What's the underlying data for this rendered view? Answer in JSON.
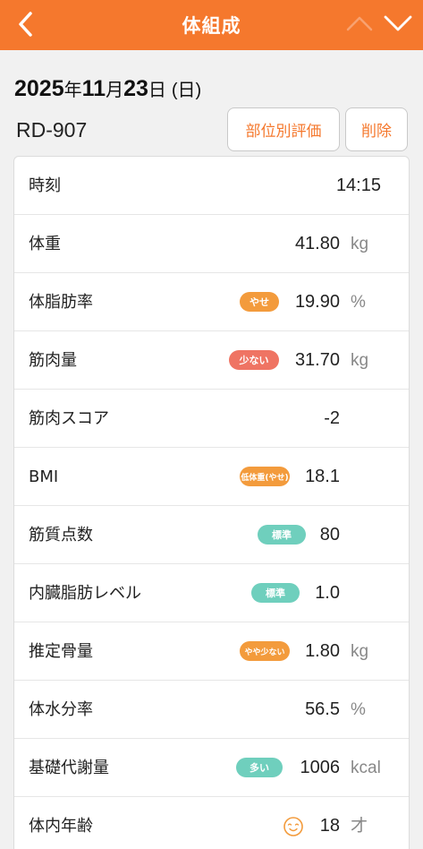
{
  "header": {
    "title": "体組成"
  },
  "record": {
    "year": "2025",
    "year_suffix": "年",
    "month": "11",
    "month_suffix": "月",
    "day": "23",
    "day_suffix": "日",
    "weekday": "(日)",
    "device": "RD-907"
  },
  "actions": {
    "body_part_label": "部位別評価",
    "delete_label": "削除"
  },
  "icons": {
    "back": "chevron-left-icon",
    "previous": "chevron-up-icon",
    "next": "chevron-down-icon",
    "body_age": "face-icon"
  },
  "colors": {
    "accent": "#f5782d",
    "badge_orange": "#f39b3c",
    "badge_red": "#ef7463",
    "badge_teal": "#6fcfbd"
  },
  "metrics": [
    {
      "label": "時刻",
      "value": "14:15",
      "unit": "",
      "badge": ""
    },
    {
      "label": "体重",
      "value": "41.80",
      "unit": "kg",
      "badge": ""
    },
    {
      "label": "体脂肪率",
      "value": "19.90",
      "unit": "%",
      "badge": "やせ"
    },
    {
      "label": "筋肉量",
      "value": "31.70",
      "unit": "kg",
      "badge": "少ない"
    },
    {
      "label": "筋肉スコア",
      "value": "-2",
      "unit": "",
      "badge": ""
    },
    {
      "label": "BMI",
      "value": "18.1",
      "unit": "",
      "badge": "低体重(やせ)"
    },
    {
      "label": "筋質点数",
      "value": "80",
      "unit": "",
      "badge": "標準"
    },
    {
      "label": "内臓脂肪レベル",
      "value": "1.0",
      "unit": "",
      "badge": "標準"
    },
    {
      "label": "推定骨量",
      "value": "1.80",
      "unit": "kg",
      "badge": "やや少ない"
    },
    {
      "label": "体水分率",
      "value": "56.5",
      "unit": "%",
      "badge": ""
    },
    {
      "label": "基礎代謝量",
      "value": "1006",
      "unit": "kcal",
      "badge": "多い"
    },
    {
      "label": "体内年齢",
      "value": "18",
      "unit": "才",
      "badge": ""
    }
  ]
}
